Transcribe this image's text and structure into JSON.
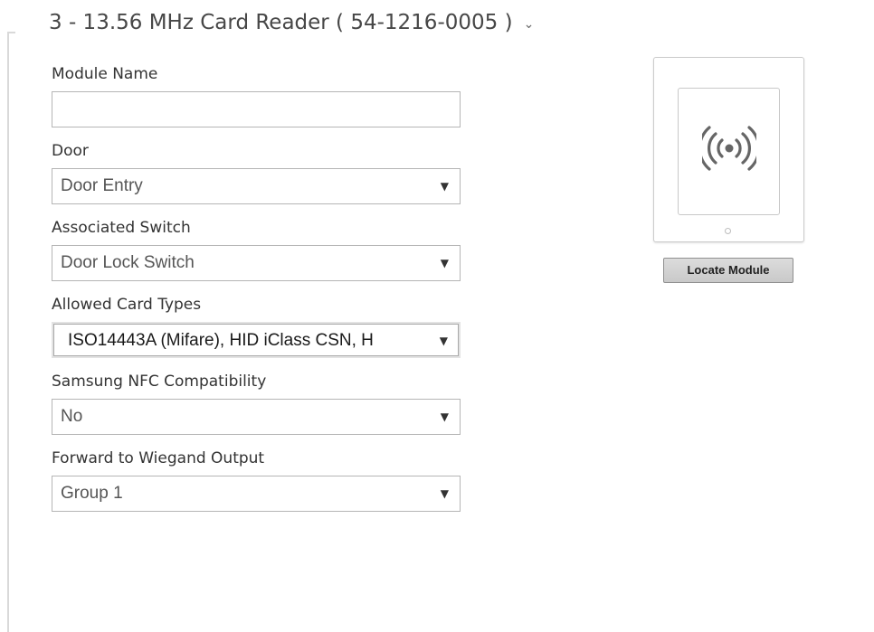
{
  "section": {
    "title": "3 - 13.56 MHz Card Reader ( 54-1216-0005 )",
    "chevron_icon": "chevron-down-icon"
  },
  "form": {
    "module_name": {
      "label": "Module Name",
      "value": "",
      "placeholder": ""
    },
    "door": {
      "label": "Door",
      "value": "Door Entry"
    },
    "associated_switch": {
      "label": "Associated Switch",
      "value": "Door Lock Switch"
    },
    "allowed_card_types": {
      "label": "Allowed Card Types",
      "value": "ISO14443A (Mifare), HID iClass CSN, H"
    },
    "samsung_nfc": {
      "label": "Samsung NFC Compatibility",
      "value": "No"
    },
    "wiegand_output": {
      "label": "Forward to Wiegand Output",
      "value": "Group 1"
    },
    "dropdown_arrow": "▼"
  },
  "module_preview": {
    "icon": "rfid-signal-icon",
    "locate_button": "Locate Module"
  },
  "colors": {
    "title": "#474747",
    "text": "#333333",
    "border": "#b5b5b5",
    "button_bg": "#d4d4d4"
  }
}
